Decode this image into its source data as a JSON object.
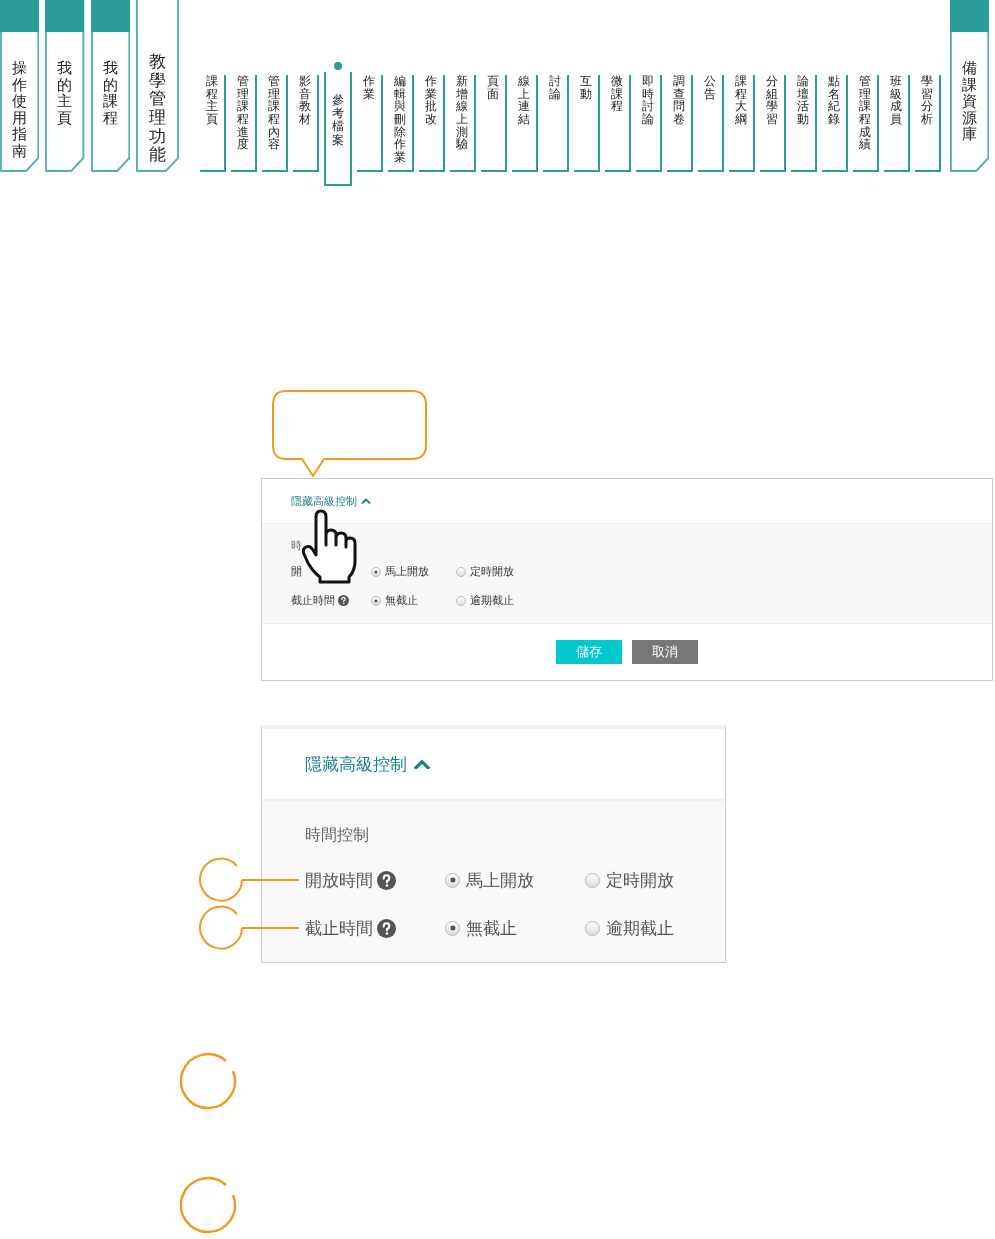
{
  "main_tabs_left": [
    {
      "label": "操作使用指南",
      "selected": false
    },
    {
      "label": "我的主頁",
      "selected": false
    },
    {
      "label": "我的課程",
      "selected": false
    },
    {
      "label": "教學管理功能",
      "selected": true
    }
  ],
  "sub_tabs": [
    {
      "label": "課程主頁",
      "selected": false
    },
    {
      "label": "管理課程進度",
      "selected": false
    },
    {
      "label": "管理課程內容",
      "selected": false
    },
    {
      "label": "影音教材",
      "selected": false
    },
    {
      "label": "參考檔案",
      "selected": true
    },
    {
      "label": "作業",
      "selected": false
    },
    {
      "label": "編輯與刪除作業",
      "selected": false
    },
    {
      "label": "作業批改",
      "selected": false
    },
    {
      "label": "新增線上測驗",
      "selected": false
    },
    {
      "label": "頁面",
      "selected": false
    },
    {
      "label": "線上連結",
      "selected": false
    },
    {
      "label": "討論",
      "selected": false
    },
    {
      "label": "互動",
      "selected": false
    },
    {
      "label": "微課程",
      "selected": false
    },
    {
      "label": "即時討論",
      "selected": false
    },
    {
      "label": "調查問卷",
      "selected": false
    },
    {
      "label": "公告",
      "selected": false
    },
    {
      "label": "課程大綱",
      "selected": false
    },
    {
      "label": "分組學習",
      "selected": false
    },
    {
      "label": "論壇活動",
      "selected": false
    },
    {
      "label": "點名紀錄",
      "selected": false
    },
    {
      "label": "管理課程成績",
      "selected": false
    },
    {
      "label": "班級成員",
      "selected": false
    },
    {
      "label": "學習分析",
      "selected": false
    }
  ],
  "main_tabs_right": [
    {
      "label": "備課資源庫",
      "selected": false
    }
  ],
  "preview_panel": {
    "toggle": "隱藏高級控制",
    "section_title": "時",
    "rows": [
      {
        "label": "開",
        "options": [
          {
            "label": "馬上開放",
            "selected": true
          },
          {
            "label": "定時開放",
            "selected": false
          }
        ]
      },
      {
        "label": "截止時間",
        "options": [
          {
            "label": "無截止",
            "selected": true
          },
          {
            "label": "逾期截止",
            "selected": false
          }
        ]
      }
    ],
    "buttons": [
      {
        "label": "儲存",
        "kind": "primary"
      },
      {
        "label": "取消",
        "kind": "secondary"
      }
    ]
  },
  "detail_panel": {
    "toggle": "隱藏高級控制",
    "section_title": "時間控制",
    "rows": [
      {
        "label": "開放時間",
        "options": [
          {
            "label": "馬上開放",
            "selected": true
          },
          {
            "label": "定時開放",
            "selected": false
          }
        ]
      },
      {
        "label": "截止時間",
        "options": [
          {
            "label": "無截止",
            "selected": true
          },
          {
            "label": "逾期截止",
            "selected": false
          }
        ]
      }
    ]
  }
}
